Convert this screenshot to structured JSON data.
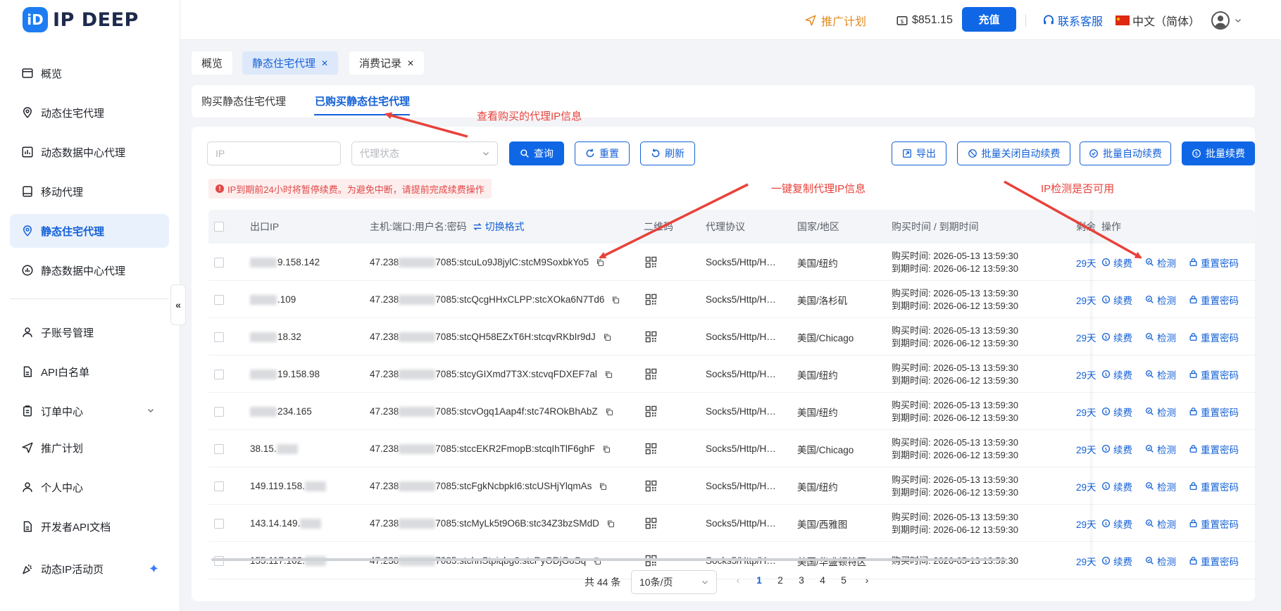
{
  "brand": {
    "mark": "iD",
    "name": "IP DEEP"
  },
  "sidebar": {
    "items": [
      {
        "label": "概览",
        "icon": "dashboard-icon"
      },
      {
        "label": "动态住宅代理",
        "icon": "location-pin-icon"
      },
      {
        "label": "动态数据中心代理",
        "icon": "bar-chart-icon"
      },
      {
        "label": "移动代理",
        "icon": "mobile-icon"
      },
      {
        "label": "静态住宅代理",
        "icon": "location-pin-icon"
      },
      {
        "label": "静态数据中心代理",
        "icon": "chart-circle-icon"
      },
      {
        "label": "子账号管理",
        "icon": "user-icon"
      },
      {
        "label": "API白名单",
        "icon": "document-icon"
      },
      {
        "label": "订单中心",
        "icon": "clipboard-icon"
      },
      {
        "label": "推广计划",
        "icon": "send-icon"
      },
      {
        "label": "个人中心",
        "icon": "user-icon"
      },
      {
        "label": "开发者API文档",
        "icon": "document-icon"
      },
      {
        "label": "动态IP活动页",
        "icon": "party-icon"
      }
    ],
    "collapse_glyph": "«"
  },
  "topbar": {
    "promo": "推广计划",
    "balance": "$851.15",
    "recharge": "充值",
    "support": "联系客服",
    "language": "中文（简体）"
  },
  "page_tabs": [
    {
      "label": "概览"
    },
    {
      "label": "静态住宅代理"
    },
    {
      "label": "消费记录"
    }
  ],
  "subtabs": [
    "购买静态住宅代理",
    "已购买静态住宅代理"
  ],
  "filters": {
    "ip_placeholder": "IP",
    "status_placeholder": "代理状态",
    "query": "查询",
    "reset": "重置",
    "refresh": "刷新",
    "export": "导出",
    "batch_disable_auto": "批量关闭自动续费",
    "batch_auto": "批量自动续费",
    "batch_renew": "批量续费"
  },
  "alert": "IP到期前24小时将暂停续费。为避免中断，请提前完成续费操作",
  "table": {
    "headers": {
      "exit_ip": "出口IP",
      "host": "主机:端口:用户名:密码",
      "switch_format": "切换格式",
      "qr": "二维码",
      "protocol": "代理协议",
      "region": "国家/地区",
      "time": "购买时间 / 到期时间",
      "remaining": "剩余",
      "actions": "操作"
    },
    "rows": [
      {
        "ip_suffix": "9.158.142",
        "ip_prefix": "",
        "host_prefix": "47.238",
        "cred": "7085:stcuLo9J8jylC:stcM9SoxbkYo5",
        "protocol": "Socks5/Http/H…",
        "region": "美国/纽约",
        "buy": "购买时间: 2026-05-13 13:59:30",
        "expire": "到期时间: 2026-06-12 13:59:30",
        "days": "29天"
      },
      {
        "ip_suffix": ".109",
        "ip_prefix": "",
        "host_prefix": "47.238",
        "cred": "7085:stcQcgHHxCLPP:stcXOka6N7Td6",
        "protocol": "Socks5/Http/H…",
        "region": "美国/洛杉矶",
        "buy": "购买时间: 2026-05-13 13:59:30",
        "expire": "到期时间: 2026-06-12 13:59:30",
        "days": "29天"
      },
      {
        "ip_suffix": "18.32",
        "ip_prefix": "",
        "host_prefix": "47.238",
        "cred": "7085:stcQH58EZxT6H:stcqvRKbIr9dJ",
        "protocol": "Socks5/Http/H…",
        "region": "美国/Chicago",
        "buy": "购买时间: 2026-05-13 13:59:30",
        "expire": "到期时间: 2026-06-12 13:59:30",
        "days": "29天"
      },
      {
        "ip_suffix": "19.158.98",
        "ip_prefix": "",
        "host_prefix": "47.238",
        "cred": "7085:stcyGIXmd7T3X:stcvqFDXEF7al",
        "protocol": "Socks5/Http/H…",
        "region": "美国/纽约",
        "buy": "购买时间: 2026-05-13 13:59:30",
        "expire": "到期时间: 2026-06-12 13:59:30",
        "days": "29天"
      },
      {
        "ip_suffix": "234.165",
        "ip_prefix": "",
        "host_prefix": "47.238",
        "cred": "7085:stcvOgq1Aap4f:stc74ROkBhAbZ",
        "protocol": "Socks5/Http/H…",
        "region": "美国/纽约",
        "buy": "购买时间: 2026-05-13 13:59:30",
        "expire": "到期时间: 2026-06-12 13:59:30",
        "days": "29天"
      },
      {
        "ip_suffix": "",
        "ip_prefix": "38.15.",
        "host_prefix": "47.238",
        "cred": "7085:stccEKR2FmopB:stcqIhTlF6ghF",
        "protocol": "Socks5/Http/H…",
        "region": "美国/Chicago",
        "buy": "购买时间: 2026-05-13 13:59:30",
        "expire": "到期时间: 2026-06-12 13:59:30",
        "days": "29天"
      },
      {
        "ip_suffix": "",
        "ip_prefix": "149.119.158.",
        "host_prefix": "47.238",
        "cred": "7085:stcFgkNcbpkI6:stcUSHjYlqmAs",
        "protocol": "Socks5/Http/H…",
        "region": "美国/纽约",
        "buy": "购买时间: 2026-05-13 13:59:30",
        "expire": "到期时间: 2026-06-12 13:59:30",
        "days": "29天"
      },
      {
        "ip_suffix": "",
        "ip_prefix": "143.14.149.",
        "host_prefix": "47.238",
        "cred": "7085:stcMyLk5t9O6B:stc34Z3bzSMdD",
        "protocol": "Socks5/Http/H…",
        "region": "美国/西雅图",
        "buy": "购买时间: 2026-05-13 13:59:30",
        "expire": "到期时间: 2026-06-12 13:59:30",
        "days": "29天"
      },
      {
        "ip_suffix": "",
        "ip_prefix": "155.117.162.",
        "host_prefix": "47.238",
        "cred": "7085:stchnStpiqbg6:stcPyODjGoSq",
        "protocol": "Socks5/Http/H…",
        "region": "美国/华盛顿特区",
        "buy": "购买时间: 2026-05-13 13:59:30",
        "expire": "",
        "days": "29天"
      }
    ],
    "actions": {
      "renew": "续费",
      "check": "检测",
      "reset_pwd": "重置密码"
    }
  },
  "pagination": {
    "total": "共 44 条",
    "page_size": "10条/页",
    "pages": [
      "1",
      "2",
      "3",
      "4",
      "5"
    ],
    "current": "1"
  },
  "annotations": {
    "view_info": "查看购买的代理IP信息",
    "copy_info": "一键复制代理IP信息",
    "check_ip": "IP检测是否可用"
  },
  "colors": {
    "accent": "#1067e6",
    "annotation": "#e8413a",
    "promo": "#e38a1e"
  }
}
